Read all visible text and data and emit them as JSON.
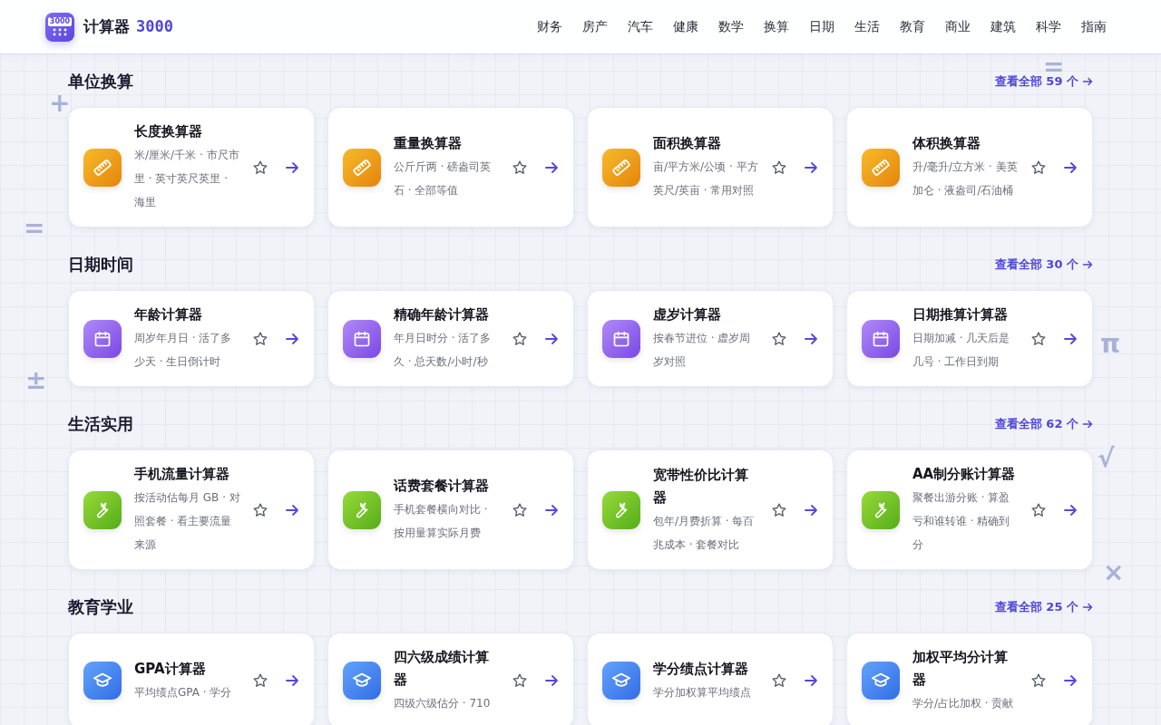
{
  "header": {
    "logo": {
      "badge_text": "3000",
      "name": "计算器",
      "number": "3000"
    },
    "nav": [
      "财务",
      "房产",
      "汽车",
      "健康",
      "数学",
      "换算",
      "日期",
      "生活",
      "教育",
      "商业",
      "建筑",
      "科学",
      "指南"
    ]
  },
  "decorations": [
    "+",
    "=",
    "=",
    "π",
    "±",
    "√",
    "×"
  ],
  "sections": [
    {
      "title": "单位换算",
      "view_all": "查看全部 59 个",
      "kind": "ruler",
      "cards": [
        {
          "title": "长度换算器",
          "desc": "米/厘米/千米 · 市尺市里 · 英寸英尺英里 · 海里",
          "favorite": false
        },
        {
          "title": "重量换算器",
          "desc": "公斤斤两 · 磅盎司英石 · 全部等值",
          "favorite": false
        },
        {
          "title": "面积换算器",
          "desc": "亩/平方米/公顷 · 平方英尺/英亩 · 常用对照",
          "favorite": false
        },
        {
          "title": "体积换算器",
          "desc": "升/毫升/立方米 · 美英加仑 · 液盎司/石油桶",
          "favorite": false
        }
      ]
    },
    {
      "title": "日期时间",
      "view_all": "查看全部 30 个",
      "kind": "calendar",
      "cards": [
        {
          "title": "年龄计算器",
          "desc": "周岁年月日 · 活了多少天 · 生日倒计时",
          "favorite": false
        },
        {
          "title": "精确年龄计算器",
          "desc": "年月日时分 · 活了多久 · 总天数/小时/秒",
          "favorite": false
        },
        {
          "title": "虚岁计算器",
          "desc": "按春节进位 · 虚岁周岁对照",
          "favorite": false
        },
        {
          "title": "日期推算计算器",
          "desc": "日期加减 · 几天后是几号 · 工作日到期",
          "favorite": false
        }
      ]
    },
    {
      "title": "生活实用",
      "view_all": "查看全部 62 个",
      "kind": "wrench",
      "cards": [
        {
          "title": "手机流量计算器",
          "desc": "按活动估每月 GB · 对照套餐 · 看主要流量来源",
          "favorite": false
        },
        {
          "title": "话费套餐计算器",
          "desc": "手机套餐横向对比 · 按用量算实际月费",
          "favorite": false
        },
        {
          "title": "宽带性价比计算器",
          "desc": "包年/月费折算 · 每百兆成本 · 套餐对比",
          "favorite": false
        },
        {
          "title": "AA制分账计算器",
          "desc": "聚餐出游分账 · 算盈亏和谁转谁 · 精确到分",
          "favorite": false
        }
      ]
    },
    {
      "title": "教育学业",
      "view_all": "查看全部 25 个",
      "kind": "cap",
      "cards": [
        {
          "title": "GPA计算器",
          "desc": "平均绩点GPA · 学分",
          "favorite": false
        },
        {
          "title": "四六级成绩计算器",
          "desc": "四级六级估分 · 710",
          "favorite": false
        },
        {
          "title": "学分绩点计算器",
          "desc": "学分加权算平均绩点",
          "favorite": false
        },
        {
          "title": "加权平均分计算器",
          "desc": "学分/占比加权 · 贡献",
          "favorite": false
        }
      ]
    }
  ]
}
